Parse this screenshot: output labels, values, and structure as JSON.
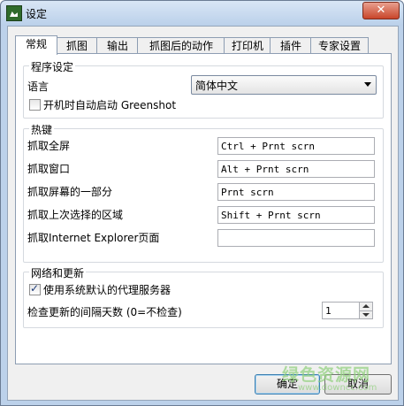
{
  "window": {
    "title": "设定",
    "close_symbol": "✕"
  },
  "tabs": [
    {
      "label": "常规"
    },
    {
      "label": "抓图"
    },
    {
      "label": "输出"
    },
    {
      "label": "抓图后的动作"
    },
    {
      "label": "打印机"
    },
    {
      "label": "插件"
    },
    {
      "label": "专家设置"
    }
  ],
  "program_settings": {
    "legend": "程序设定",
    "language_label": "语言",
    "language_value": "简体中文",
    "autostart_label": "开机时自动启动 Greenshot",
    "autostart_checked": false
  },
  "hotkeys": {
    "legend": "热键",
    "rows": [
      {
        "label": "抓取全屏",
        "value": "Ctrl + Prnt scrn"
      },
      {
        "label": "抓取窗口",
        "value": "Alt + Prnt scrn"
      },
      {
        "label": "抓取屏幕的一部分",
        "value": "Prnt scrn"
      },
      {
        "label": "抓取上次选择的区域",
        "value": "Shift + Prnt scrn"
      },
      {
        "label": "抓取Internet Explorer页面",
        "value": ""
      }
    ]
  },
  "network": {
    "legend": "网络和更新",
    "proxy_label": "使用系统默认的代理服务器",
    "proxy_checked": true,
    "interval_label": "检查更新的间隔天数 (0=不检查)",
    "interval_value": "1"
  },
  "buttons": {
    "ok": "确定",
    "cancel": "取消"
  },
  "watermark": {
    "text": "绿色资源网",
    "sub": "www.downcc.com"
  }
}
